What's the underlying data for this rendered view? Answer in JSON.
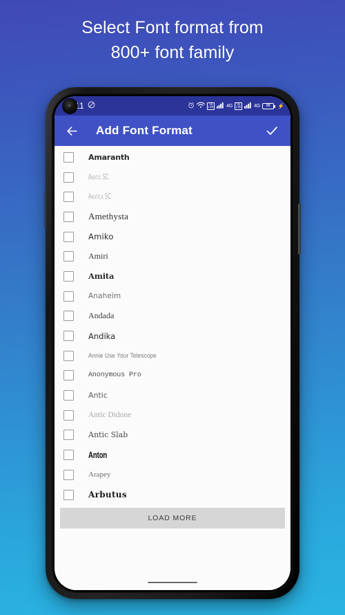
{
  "promo": {
    "line1": "Select Font format from",
    "line2": "800+ font family"
  },
  "colors": {
    "bg_gradient_start": "#4048b8",
    "bg_gradient_end": "#29b3e2",
    "statusbar": "#2b3499",
    "appbar": "#3f51c5",
    "loadmore_bg": "#d6d6d6",
    "list_bg": "#fbfbfb"
  },
  "statusbar": {
    "time": "11",
    "mute_icon": "mute-icon",
    "alarm_icon": "alarm-icon",
    "wifi_icon": "wifi-icon",
    "volte1_label": "VoLTE",
    "volte1_line1": "Vo",
    "volte1_line2": "LTE",
    "signal1_icon": "signal-bars-icon",
    "network1_label": "4G",
    "volte2_line1": "Vo",
    "volte2_line2": "LTE",
    "signal2_icon": "signal-bars-icon",
    "network2_label": "4G",
    "battery_level": "88",
    "charging_icon": "charging-bolt-icon"
  },
  "appbar": {
    "back_icon": "back-arrow-icon",
    "title": "Add Font Format",
    "confirm_icon": "checkmark-icon"
  },
  "list": {
    "items": [
      {
        "name": "Amaranth",
        "style": "f-amaranth"
      },
      {
        "name": "Amatic SC",
        "style": "f-amatic"
      },
      {
        "name": "Amatica SC",
        "style": "f-amatica"
      },
      {
        "name": "Amethysta",
        "style": "f-amethysta"
      },
      {
        "name": "Amiko",
        "style": "f-amiko"
      },
      {
        "name": "Amiri",
        "style": "f-amiri"
      },
      {
        "name": "Amita",
        "style": "f-amita"
      },
      {
        "name": "Anaheim",
        "style": "f-anaheim"
      },
      {
        "name": "Andada",
        "style": "f-andada"
      },
      {
        "name": "Andika",
        "style": "f-andika"
      },
      {
        "name": "Annie Use Your Telescope",
        "style": "f-annie"
      },
      {
        "name": "Anonymous Pro",
        "style": "f-anonymous"
      },
      {
        "name": "Antic",
        "style": "f-antic"
      },
      {
        "name": "Antic Didone",
        "style": "f-anticdid"
      },
      {
        "name": "Antic Slab",
        "style": "f-anticslab"
      },
      {
        "name": "Anton",
        "style": "f-anton"
      },
      {
        "name": "Arapey",
        "style": "f-arapey"
      },
      {
        "name": "Arbutus",
        "style": "f-arbutus"
      }
    ],
    "load_more_label": "LOAD MORE"
  }
}
